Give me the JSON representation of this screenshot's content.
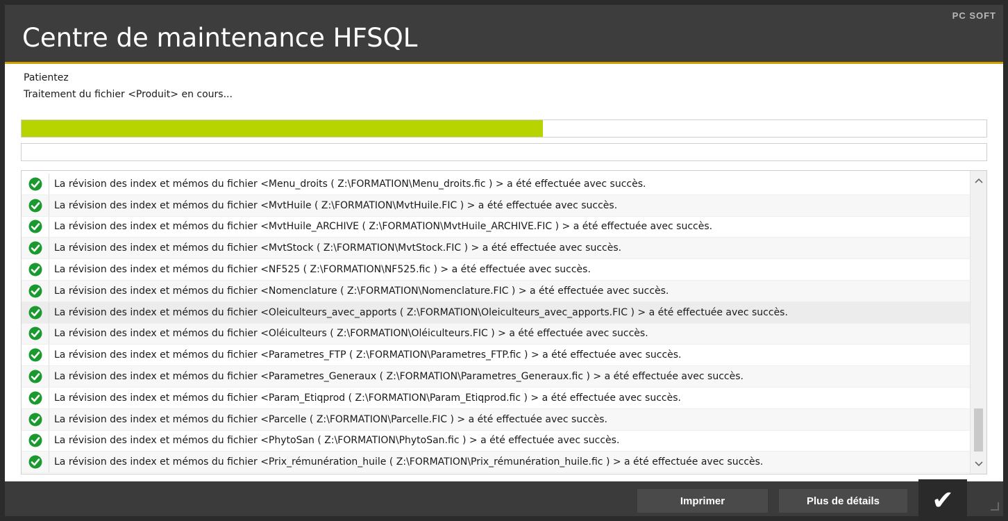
{
  "window": {
    "title": "Centre de maintenance HFSQL",
    "brand": "PC SOFT"
  },
  "status": {
    "line1": "Patientez",
    "line2": "Traitement du fichier <Produit> en cours..."
  },
  "progress": {
    "main_fraction": 0.54,
    "secondary_fraction": 0.0,
    "fill_color": "#b8d400"
  },
  "log": {
    "icon": "check-circle-icon",
    "icon_color": "#1a9a2e",
    "entries": [
      "La révision des index et mémos du fichier <Menu_droits ( Z:\\FORMATION\\Menu_droits.fic ) > a été effectuée avec succès.",
      "La révision des index et mémos du fichier <MvtHuile ( Z:\\FORMATION\\MvtHuile.FIC ) > a été effectuée avec succès.",
      "La révision des index et mémos du fichier <MvtHuile_ARCHIVE ( Z:\\FORMATION\\MvtHuile_ARCHIVE.FIC ) > a été effectuée avec succès.",
      "La révision des index et mémos du fichier <MvtStock ( Z:\\FORMATION\\MvtStock.FIC ) > a été effectuée avec succès.",
      "La révision des index et mémos du fichier <NF525 ( Z:\\FORMATION\\NF525.fic ) > a été effectuée avec succès.",
      "La révision des index et mémos du fichier <Nomenclature ( Z:\\FORMATION\\Nomenclature.FIC ) > a été effectuée avec succès.",
      "La révision des index et mémos du fichier <Oleiculteurs_avec_apports ( Z:\\FORMATION\\Oleiculteurs_avec_apports.FIC ) > a été effectuée avec succès.",
      "La révision des index et mémos du fichier <Oléiculteurs ( Z:\\FORMATION\\Oléiculteurs.FIC ) > a été effectuée avec succès.",
      "La révision des index et mémos du fichier <Parametres_FTP ( Z:\\FORMATION\\Parametres_FTP.fic ) > a été effectuée avec succès.",
      "La révision des index et mémos du fichier <Parametres_Generaux ( Z:\\FORMATION\\Parametres_Generaux.fic ) > a été effectuée avec succès.",
      "La révision des index et mémos du fichier <Param_Etiqprod ( Z:\\FORMATION\\Param_Etiqprod.fic ) > a été effectuée avec succès.",
      "La révision des index et mémos du fichier <Parcelle ( Z:\\FORMATION\\Parcelle.FIC ) > a été effectuée avec succès.",
      "La révision des index et mémos du fichier <PhytoSan ( Z:\\FORMATION\\PhytoSan.fic ) > a été effectuée avec succès.",
      "La révision des index et mémos du fichier <Prix_rémunération_huile ( Z:\\FORMATION\\Prix_rémunération_huile.fic ) > a été effectuée avec succès."
    ],
    "selected_index": 6
  },
  "buttons": {
    "print_label": "Imprimer",
    "details_label": "Plus de détails",
    "ok_label": "✔"
  }
}
